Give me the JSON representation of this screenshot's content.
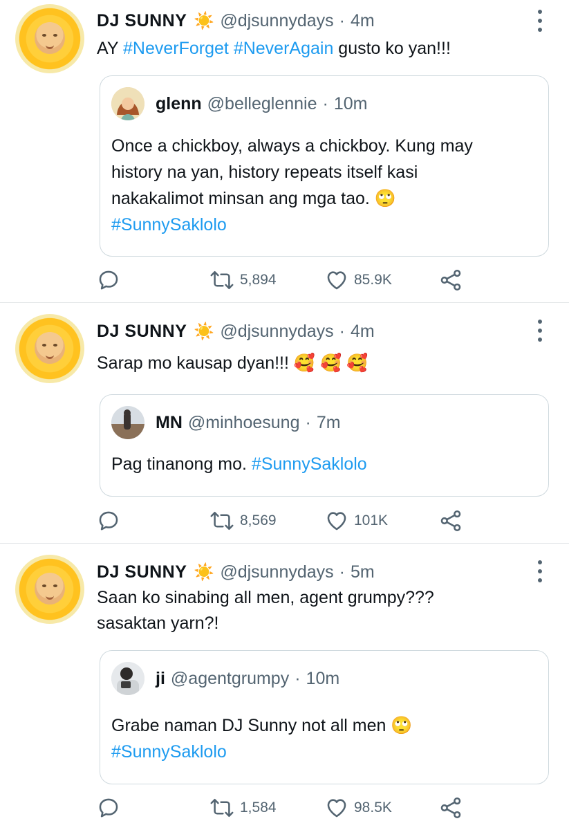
{
  "tweets": [
    {
      "name": "DJ SUNNY",
      "sun": "☀️",
      "handle": "@djsunnydays",
      "dot": "·",
      "time": "4m",
      "text_parts": [
        "AY ",
        "#NeverForget",
        " ",
        "#NeverAgain",
        " gusto ko yan!!!"
      ],
      "quote": {
        "name": "glenn",
        "handle": "@belleglennie",
        "dot": "·",
        "time": "10m",
        "line1": "Once a chickboy, always a chickboy. Kung may",
        "line2": "history na yan, history repeats itself kasi",
        "line3": "nakakalimot minsan ang mga tao. 🙄",
        "hashtag": "#SunnySaklolo"
      },
      "retweets": "5,894",
      "likes": "85.9K"
    },
    {
      "name": "DJ SUNNY",
      "sun": "☀️",
      "handle": "@djsunnydays",
      "dot": "·",
      "time": "4m",
      "text": "Sarap mo kausap dyan!!! 🥰 🥰 🥰",
      "quote": {
        "name": "MN",
        "handle": "@minhoesung",
        "dot": "·",
        "time": "7m",
        "line1": "Pag tinanong mo. ",
        "hashtag": "#SunnySaklolo"
      },
      "retweets": "8,569",
      "likes": "101K"
    },
    {
      "name": "DJ SUNNY",
      "sun": "☀️",
      "handle": "@djsunnydays",
      "dot": "·",
      "time": "5m",
      "line1": "Saan ko sinabing all men, agent grumpy???",
      "line2": "sasaktan yarn?!",
      "quote": {
        "name": "ji",
        "handle": "@agentgrumpy",
        "dot": "·",
        "time": "10m",
        "line1": "Grabe naman DJ Sunny not all men 🙄",
        "hashtag": "#SunnySaklolo"
      },
      "retweets": "1,584",
      "likes": "98.5K"
    }
  ],
  "colors": {
    "link": "#1d9bf0",
    "muted": "#536471",
    "text": "#0f1419",
    "border": "#cfd9de"
  },
  "icons": [
    "reply-icon",
    "retweet-icon",
    "like-icon",
    "share-icon",
    "more-icon"
  ]
}
